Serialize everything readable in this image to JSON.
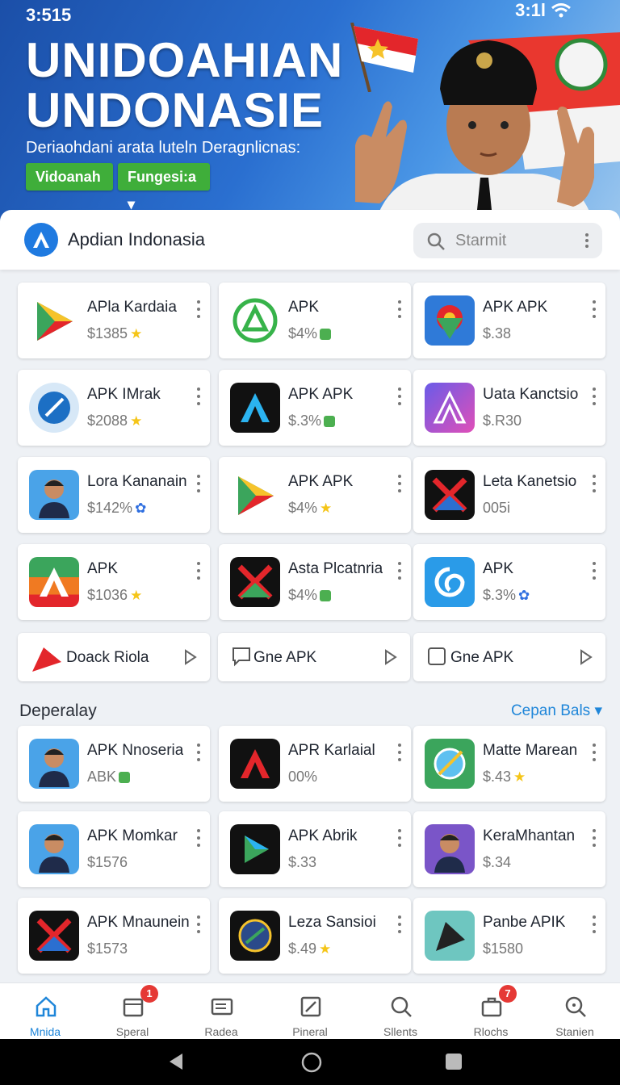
{
  "status": {
    "time": "3:515",
    "right": "3:1l"
  },
  "banner": {
    "title_line1": "UNIDOAHIAN",
    "title_line2": "UNDONASIE",
    "subtitle": "Deriaohdani arata luteln Deragnlicnas:",
    "pill1": "Vidoanah",
    "pill2": "Fungesi:a ▾"
  },
  "header": {
    "title": "Apdian Indonasia",
    "search_placeholder": "Starmit"
  },
  "grid": [
    {
      "name": "APla Kardaia",
      "price": "$1385",
      "badge": "star"
    },
    {
      "name": "APK",
      "price": "$4%",
      "badge": "dl"
    },
    {
      "name": "APK APK",
      "price": "$.38",
      "badge": ""
    },
    {
      "name": "APK IMrak",
      "price": "$2088",
      "badge": "star"
    },
    {
      "name": "APK APK",
      "price": "$.3%",
      "badge": "dl"
    },
    {
      "name": "Uata Kanctsio",
      "price": "$.R30",
      "badge": ""
    },
    {
      "name": "Lora Kananain",
      "price": "$142%",
      "badge": "gear"
    },
    {
      "name": "APK APK",
      "price": "$4%",
      "badge": "star"
    },
    {
      "name": "Leta Kanetsio",
      "price": "005i",
      "badge": ""
    },
    {
      "name": "APK",
      "price": "$1036",
      "badge": "star"
    },
    {
      "name": "Asta Plcatnria",
      "price": "$4%",
      "badge": "dl"
    },
    {
      "name": "APK",
      "price": "$.3%",
      "badge": "gear"
    }
  ],
  "wide_row": [
    {
      "label": "Doack Riola"
    },
    {
      "label": "Gne APK"
    },
    {
      "label": "Gne APK"
    }
  ],
  "section": {
    "title": "Deperalay",
    "link": "Cepan Bals ▾"
  },
  "grid2": [
    {
      "name": "APK Nnoseria",
      "price": "ABK",
      "badge": "dl"
    },
    {
      "name": "APR Karlaial",
      "price": "00%",
      "badge": ""
    },
    {
      "name": "Matte Marean",
      "price": "$.43",
      "badge": "star"
    },
    {
      "name": "APK Momkar",
      "price": "$1576",
      "badge": ""
    },
    {
      "name": "APK Abrik",
      "price": "$.33",
      "badge": ""
    },
    {
      "name": "KeraMhantan",
      "price": "$.34",
      "badge": ""
    },
    {
      "name": "APK Mnaunein",
      "price": "$1573",
      "badge": ""
    },
    {
      "name": "Leza Sansioi",
      "price": "$.49",
      "badge": "star"
    },
    {
      "name": "Panbe APIK",
      "price": "$1580",
      "badge": ""
    }
  ],
  "nav": [
    {
      "label": "Mnida",
      "icon": "home-icon",
      "badge": ""
    },
    {
      "label": "Speral",
      "icon": "calendar-icon",
      "badge": "1"
    },
    {
      "label": "Radea",
      "icon": "news-icon",
      "badge": ""
    },
    {
      "label": "Pineral",
      "icon": "edit-icon",
      "badge": ""
    },
    {
      "label": "Sllents",
      "icon": "search-icon",
      "badge": ""
    },
    {
      "label": "Rlochs",
      "icon": "briefcase-icon",
      "badge": "7"
    },
    {
      "label": "Stanien",
      "icon": "zoom-icon",
      "badge": ""
    }
  ],
  "colors": {
    "accent": "#1f86d9",
    "banner": "#2a6fd0",
    "green": "#3fae3a",
    "badge": "#e53935"
  }
}
